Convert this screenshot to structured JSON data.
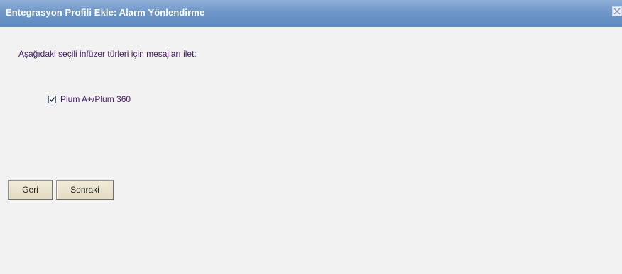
{
  "window": {
    "title": "Entegrasyon Profili Ekle: Alarm Yönlendirme",
    "close_icon": "close-icon"
  },
  "main": {
    "prompt": "Aşağıdaki seçili infüzer türleri için mesajları ilet:",
    "pumps": [
      {
        "label": "Plum A+/Plum 360",
        "checked": true
      }
    ]
  },
  "footer": {
    "back_label": "Geri",
    "next_label": "Sonraki"
  },
  "colors": {
    "title_bar": "#6f97c8",
    "text": "#4a1a6e",
    "panel_bg": "#f2f2f2",
    "button_bg": "#e9e2cc"
  }
}
